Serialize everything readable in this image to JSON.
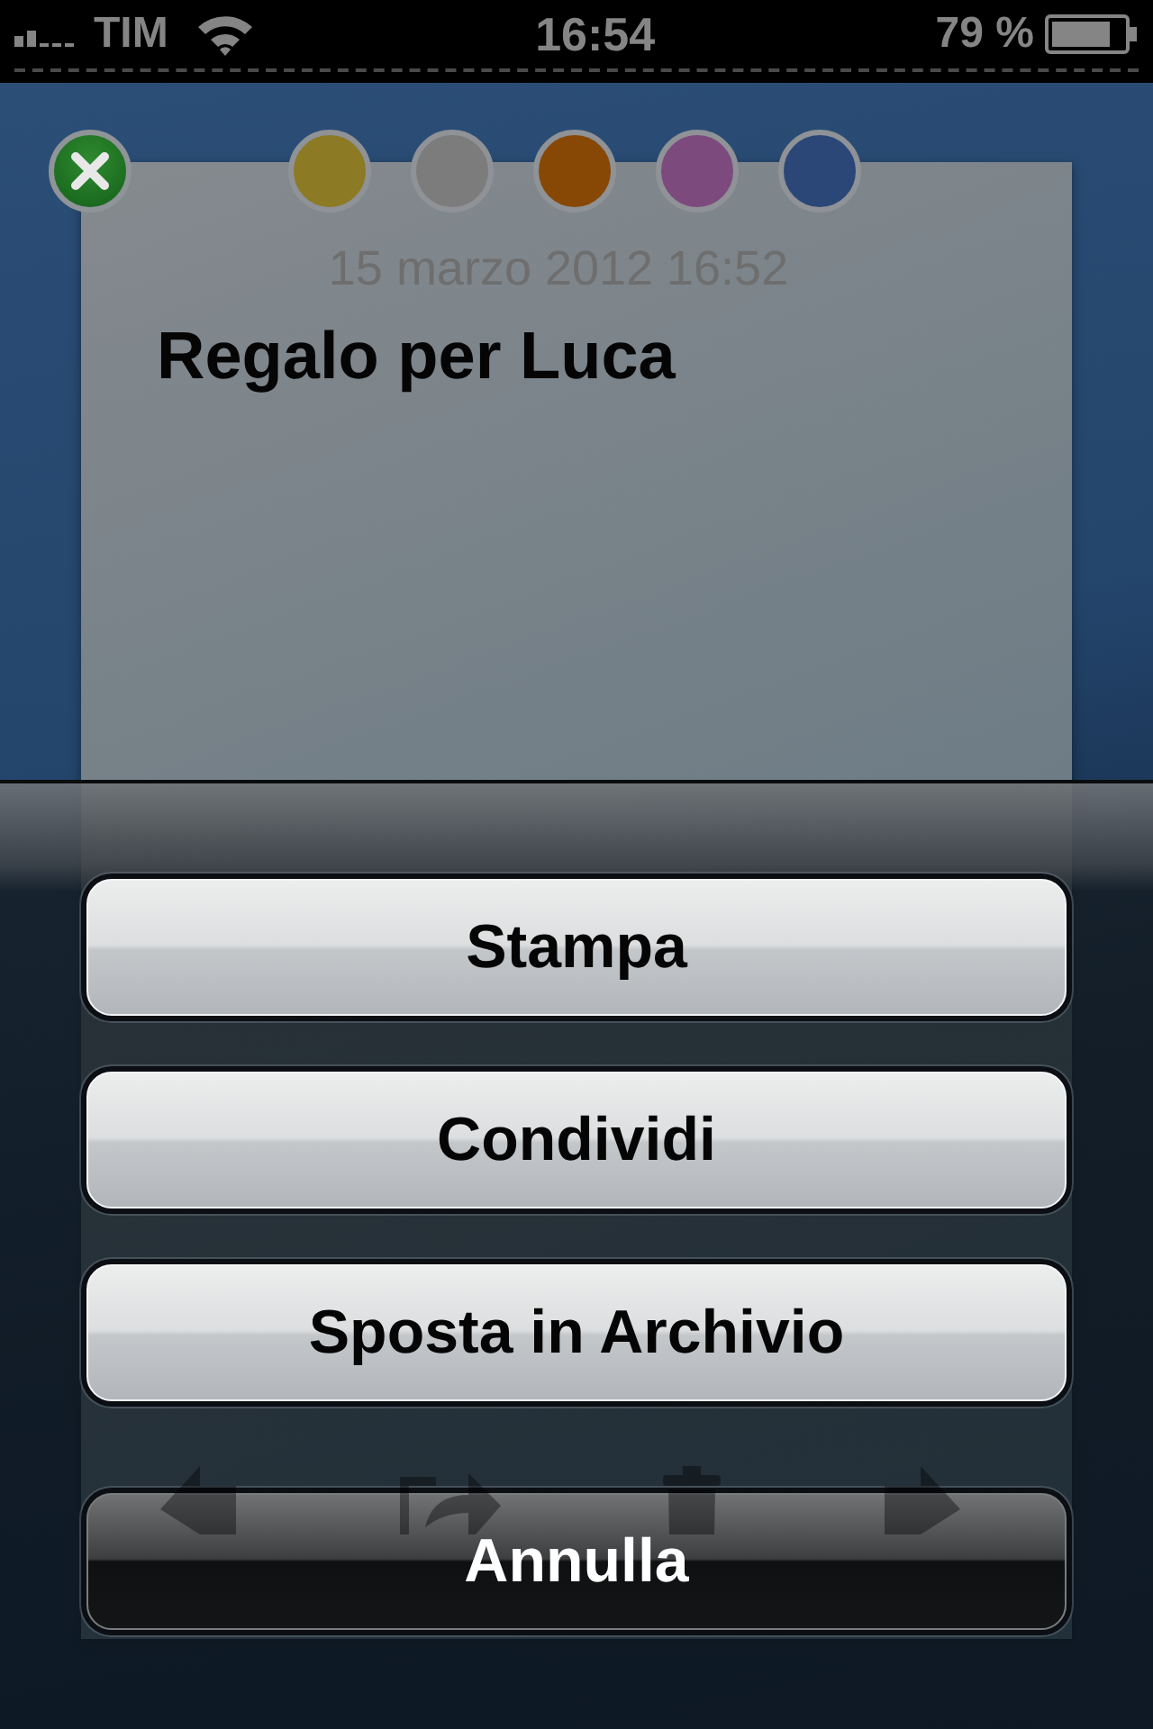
{
  "status_bar": {
    "carrier": "TIM",
    "time": "16:54",
    "battery": "79 %"
  },
  "note": {
    "colors": [
      {
        "color": "#8c7a25"
      },
      {
        "color": "#7c7c7c"
      },
      {
        "color": "#874806"
      },
      {
        "color": "#7d4a7d"
      },
      {
        "color": "#2b4778"
      }
    ],
    "date": "15 marzo 2012 16:52",
    "title": "Regalo per Luca"
  },
  "action_sheet": {
    "buttons": [
      {
        "label": "Stampa",
        "kind": "default"
      },
      {
        "label": "Condividi",
        "kind": "default"
      },
      {
        "label": "Sposta in Archivio",
        "kind": "default"
      },
      {
        "label": "Annulla",
        "kind": "cancel"
      }
    ]
  }
}
